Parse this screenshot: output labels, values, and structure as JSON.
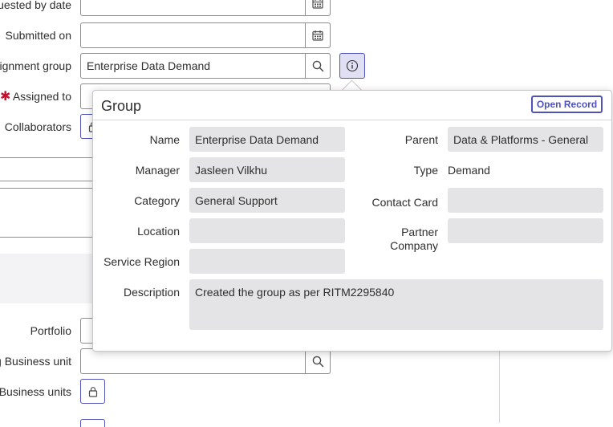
{
  "form": {
    "requested_by_date_label": "uested by date",
    "submitted_on_label": "Submitted on",
    "assignment_group_label": "ignment group",
    "assignment_group_value": "Enterprise Data Demand",
    "assigned_to_label": "Assigned to",
    "assigned_to_required_mark": "✱",
    "collaborators_label": "Collaborators",
    "portfolio_label": "Portfolio",
    "business_unit_label": "g Business unit",
    "business_units_label": "Business units"
  },
  "popup": {
    "title": "Group",
    "open_record_label": "Open Record",
    "name_label": "Name",
    "name_value": "Enterprise Data Demand",
    "parent_label": "Parent",
    "parent_value": "Data & Platforms - General",
    "manager_label": "Manager",
    "manager_value": "Jasleen Vilkhu",
    "type_label": "Type",
    "type_value": "Demand",
    "category_label": "Category",
    "category_value": "General Support",
    "contact_card_label": "Contact Card",
    "contact_card_value": "",
    "location_label": "Location",
    "location_value": "",
    "partner_company_label_1": "Partner",
    "partner_company_label_2": "Company",
    "partner_company_value": "",
    "service_region_label": "Service Region",
    "service_region_value": "",
    "description_label": "Description",
    "description_value": "Created the group as per RITM2295840"
  },
  "colors": {
    "accent": "#4f52bd",
    "readonly_bg": "#e4e4e7",
    "required": "#c8102e"
  },
  "icons": [
    "calendar-icon",
    "search-icon",
    "info-icon",
    "lock-icon"
  ]
}
